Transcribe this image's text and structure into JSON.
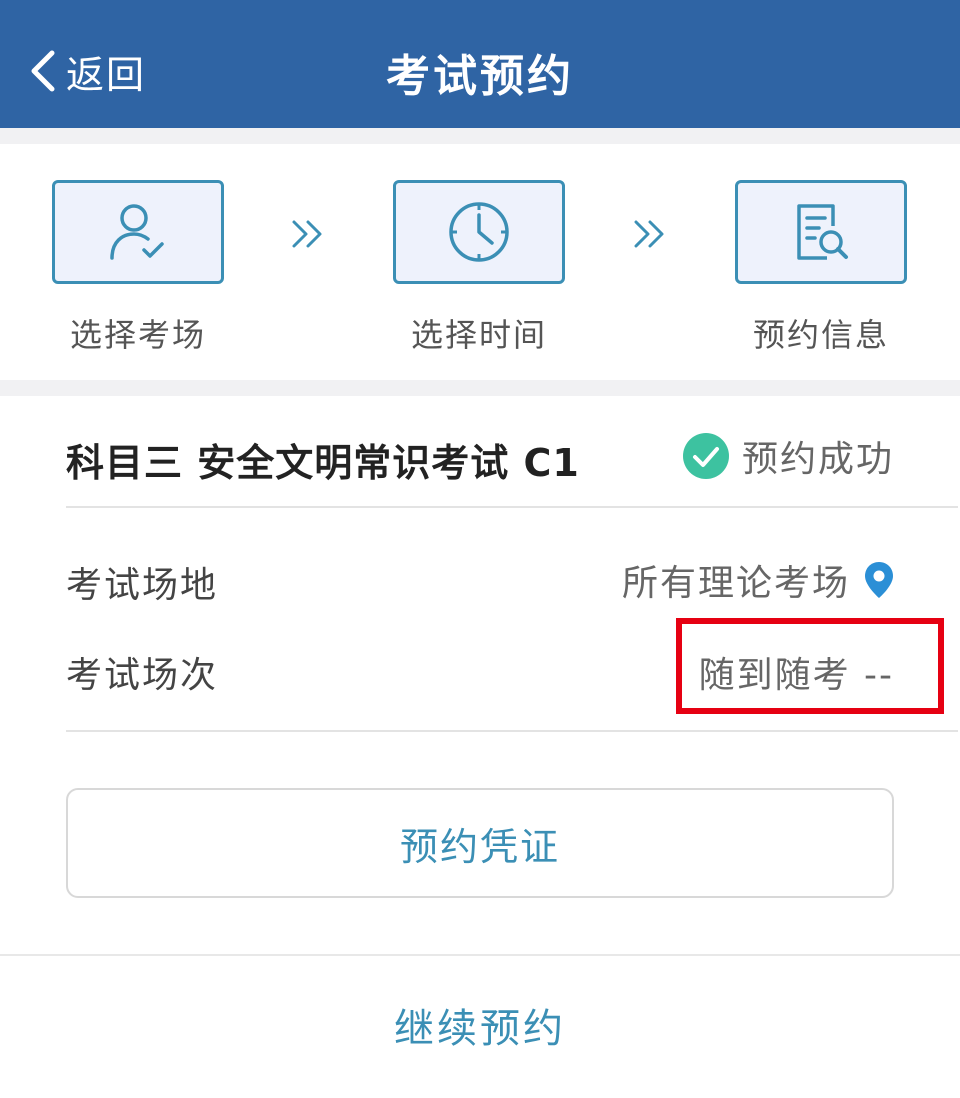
{
  "nav": {
    "back_label": "返回",
    "title": "考试预约"
  },
  "steps": [
    {
      "label": "选择考场",
      "icon": "user-check-icon"
    },
    {
      "label": "选择时间",
      "icon": "clock-icon"
    },
    {
      "label": "预约信息",
      "icon": "document-search-icon"
    }
  ],
  "booking": {
    "subject": "科目三 安全文明常识考试 C1",
    "status": "预约成功",
    "venue_label": "考试场地",
    "venue_value": "所有理论考场",
    "session_label": "考试场次",
    "session_value": "随到随考 --"
  },
  "actions": {
    "voucher": "预约凭证",
    "continue": "继续预约"
  },
  "colors": {
    "nav_bg": "#2f64a4",
    "accent": "#3b8fb5",
    "success": "#3dc2a0",
    "location": "#2b8fd6",
    "highlight": "#e60012"
  }
}
